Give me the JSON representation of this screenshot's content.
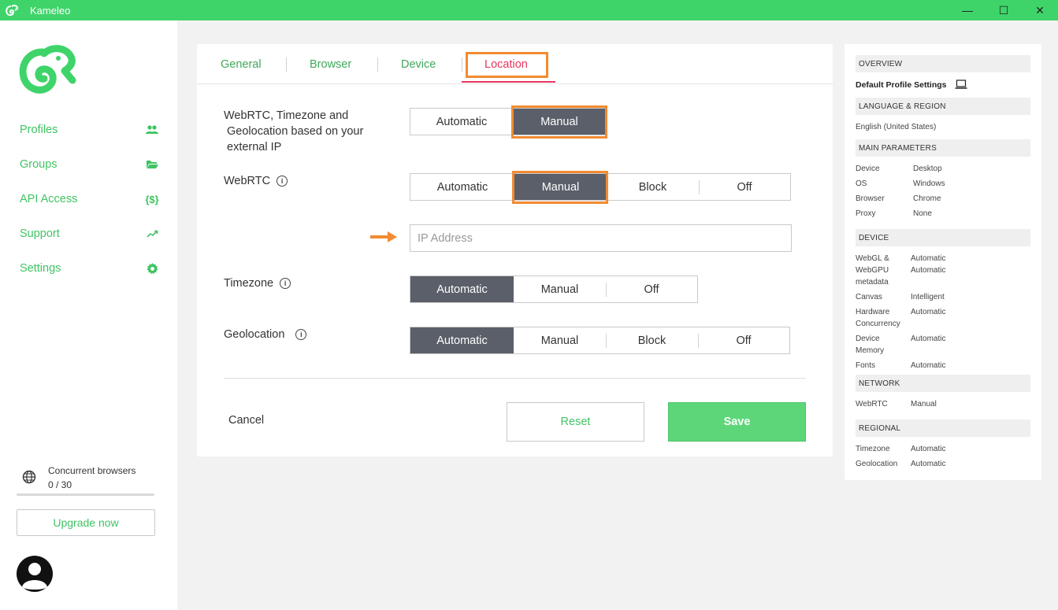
{
  "window": {
    "title": "Kameleo",
    "controls": [
      "—",
      "☐",
      "✕"
    ]
  },
  "sidebar": {
    "nav": [
      {
        "label": "Profiles",
        "icon": "users-icon"
      },
      {
        "label": "Groups",
        "icon": "folder-icon"
      },
      {
        "label": "API Access",
        "icon": "braces-icon",
        "glyph": "{$}"
      },
      {
        "label": "Support",
        "icon": "trending-up-icon"
      },
      {
        "label": "Settings",
        "icon": "gear-icon"
      }
    ],
    "concurrent": {
      "label": "Concurrent browsers",
      "value": "0 / 30",
      "fraction": 0.0
    },
    "upgrade_label": "Upgrade now"
  },
  "tabs": [
    {
      "label": "General"
    },
    {
      "label": "Browser"
    },
    {
      "label": "Device"
    },
    {
      "label": "Location",
      "active": true
    }
  ],
  "location": {
    "based_on_ip": {
      "label": "WebRTC, Timezone and Geolocation based on your external IP",
      "line1": "WebRTC, Timezone and",
      "line2": "Geolocation based on your",
      "line3": "external IP",
      "options": [
        "Automatic",
        "Manual"
      ],
      "selected": "Manual"
    },
    "webrtc": {
      "label": "WebRTC",
      "options": [
        "Automatic",
        "Manual",
        "Block",
        "Off"
      ],
      "selected": "Manual",
      "ip_placeholder": "IP Address"
    },
    "timezone": {
      "label": "Timezone",
      "options": [
        "Automatic",
        "Manual",
        "Off"
      ],
      "selected": "Automatic"
    },
    "geolocation": {
      "label": "Geolocation",
      "options": [
        "Automatic",
        "Manual",
        "Block",
        "Off"
      ],
      "selected": "Automatic"
    }
  },
  "actions": {
    "cancel": "Cancel",
    "reset": "Reset",
    "save": "Save"
  },
  "overview": {
    "overview_header": "OVERVIEW",
    "profile_name": "Default Profile Settings",
    "lang_header": "LANGUAGE & REGION",
    "language": "English (United States)",
    "main_header": "MAIN PARAMETERS",
    "main": [
      {
        "k": "Device",
        "v": "Desktop"
      },
      {
        "k": "OS",
        "v": "Windows"
      },
      {
        "k": "Browser",
        "v": "Chrome"
      },
      {
        "k": "Proxy",
        "v": "None"
      }
    ],
    "device_header": "DEVICE",
    "device": {
      "webgl_k1": "WebGL &",
      "webgl_k2": "WebGPU",
      "webgl_k3": "metadata",
      "webgl_v1": "Automatic",
      "webgl_v2": "Automatic",
      "canvas_k": "Canvas",
      "canvas_v": "Intelligent",
      "hw_k1": "Hardware",
      "hw_k2": "Concurrency",
      "hw_v": "Automatic",
      "mem_k1": "Device",
      "mem_k2": "Memory",
      "mem_v": "Automatic",
      "fonts_k": "Fonts",
      "fonts_v": "Automatic"
    },
    "network_header": "NETWORK",
    "network": {
      "k": "WebRTC",
      "v": "Manual"
    },
    "regional_header": "REGIONAL",
    "regional": [
      {
        "k": "Timezone",
        "v": "Automatic"
      },
      {
        "k": "Geolocation",
        "v": "Automatic"
      }
    ]
  },
  "colors": {
    "brand_green": "#3fd46a",
    "selected_segment": "#5a5f69",
    "highlight_orange": "#f28b32",
    "active_tab": "#e8355d"
  }
}
